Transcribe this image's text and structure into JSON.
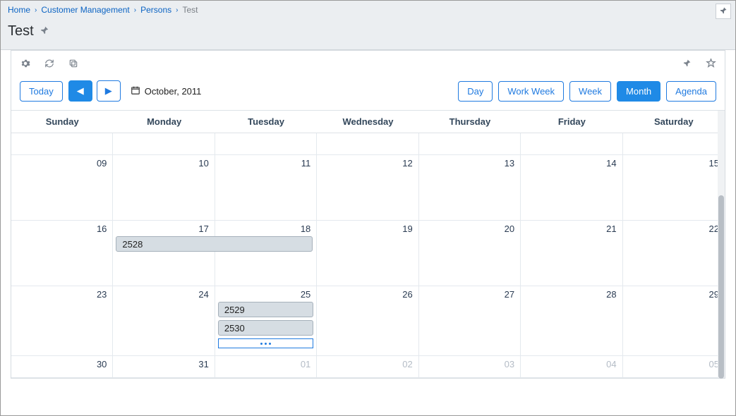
{
  "breadcrumb": {
    "home": "Home",
    "cm": "Customer Management",
    "persons": "Persons",
    "current": "Test"
  },
  "page": {
    "title": "Test"
  },
  "nav": {
    "today": "Today",
    "date_label": "October, 2011"
  },
  "views": {
    "day": "Day",
    "work_week": "Work Week",
    "week": "Week",
    "month": "Month",
    "agenda": "Agenda"
  },
  "dayheaders": [
    "Sunday",
    "Monday",
    "Tuesday",
    "Wednesday",
    "Thursday",
    "Friday",
    "Saturday"
  ],
  "weeks": [
    {
      "short": true,
      "days": [
        {
          "n": "",
          "other": false
        },
        {
          "n": "",
          "other": false
        },
        {
          "n": "",
          "other": false
        },
        {
          "n": "",
          "other": false
        },
        {
          "n": "",
          "other": false
        },
        {
          "n": "",
          "other": false
        },
        {
          "n": "",
          "other": false
        }
      ]
    },
    {
      "days": [
        {
          "n": "09"
        },
        {
          "n": "10"
        },
        {
          "n": "11"
        },
        {
          "n": "12"
        },
        {
          "n": "13"
        },
        {
          "n": "14"
        },
        {
          "n": "15"
        }
      ]
    },
    {
      "days": [
        {
          "n": "16"
        },
        {
          "n": "17"
        },
        {
          "n": "18"
        },
        {
          "n": "19"
        },
        {
          "n": "20"
        },
        {
          "n": "21"
        },
        {
          "n": "22"
        }
      ]
    },
    {
      "tall": true,
      "days": [
        {
          "n": "23"
        },
        {
          "n": "24"
        },
        {
          "n": "25"
        },
        {
          "n": "26"
        },
        {
          "n": "27"
        },
        {
          "n": "28"
        },
        {
          "n": "29"
        }
      ]
    },
    {
      "short": true,
      "days": [
        {
          "n": "30"
        },
        {
          "n": "31"
        },
        {
          "n": "01",
          "other": true
        },
        {
          "n": "02",
          "other": true
        },
        {
          "n": "03",
          "other": true
        },
        {
          "n": "04",
          "other": true
        },
        {
          "n": "05",
          "other": true
        }
      ]
    }
  ],
  "events": {
    "e2528": "2528",
    "e2529": "2529",
    "e2530": "2530"
  }
}
